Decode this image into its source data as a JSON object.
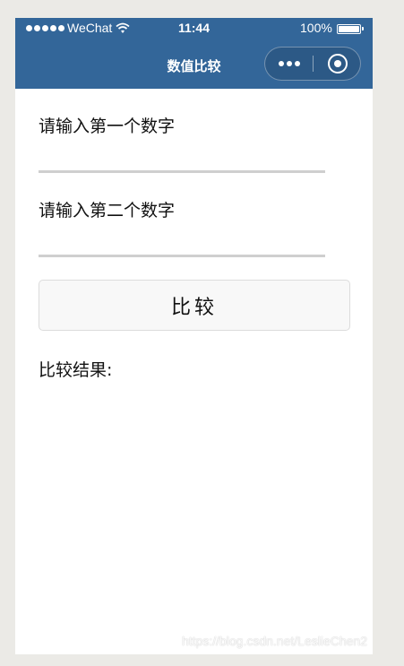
{
  "status_bar": {
    "carrier": "WeChat",
    "time": "11:44",
    "battery_percent": "100%"
  },
  "nav": {
    "title": "数值比较",
    "menu_icon": "more-dots-icon",
    "close_icon": "target-circle-icon"
  },
  "form": {
    "label_first": "请输入第一个数字",
    "input_first_value": "",
    "label_second": "请输入第二个数字",
    "input_second_value": "",
    "compare_button": "比较",
    "result_label": "比较结果:"
  },
  "watermark": "https://blog.csdn.net/LeslieChen2",
  "colors": {
    "nav_background": "#336699",
    "page_background": "#ebeae6",
    "button_background": "#f8f8f8"
  }
}
